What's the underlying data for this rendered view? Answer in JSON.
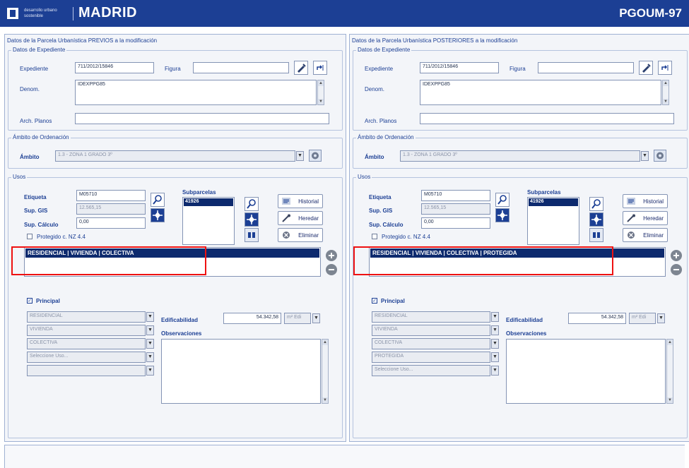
{
  "header": {
    "brand_small": "desarrollo urbano sostenible",
    "brand": "MADRID",
    "app_code": "PGOUM-97"
  },
  "left": {
    "title": "Datos de la Parcela Urbanística PREVIOS a la modificación",
    "expediente_group": "Datos de Expediente",
    "expediente_label": "Expediente",
    "expediente_value": "711/2012/15846",
    "figura_label": "Figura",
    "figura_value": "",
    "denom_label": "Denom.",
    "denom_value": "IDEXPPG85",
    "arch_label": "Arch. Planos",
    "arch_value": "",
    "ambito_group": "Ámbito de Ordenación",
    "ambito_label": "Ámbito",
    "ambito_value": "1.3 - ZONA 1 GRADO 3º",
    "usos_group": "Usos",
    "etiqueta_label": "Etiqueta",
    "etiqueta_value": "M05710",
    "sup_gis_label": "Sup. GIS",
    "sup_gis_value": "12.565,15",
    "sup_calc_label": "Sup. Cálculo",
    "sup_calc_value": "0,00",
    "protegida_label": "Protegido c. NZ 4.4",
    "subparcelas_label": "Subparcelas",
    "subparcela_item": "41926",
    "historial": "Historial",
    "heredar": "Heredar",
    "eliminar": "Eliminar",
    "uso_selected": "RESIDENCIAL | VIVIENDA | COLECTIVA",
    "principal_label": "Principal",
    "combos": [
      "RESIDENCIAL",
      "VIVIENDA",
      "COLECTIVA",
      "Seleccione Uso...",
      ""
    ],
    "edificabilidad_label": "Edificabilidad",
    "edificabilidad_value": "54.342,58",
    "edif_unit": "m² Edi",
    "observaciones_label": "Observaciones"
  },
  "right": {
    "title": "Datos de la Parcela Urbanística POSTERIORES a la modificación",
    "expediente_group": "Datos de Expediente",
    "expediente_label": "Expediente",
    "expediente_value": "711/2012/15846",
    "figura_label": "Figura",
    "figura_value": "",
    "denom_label": "Denom.",
    "denom_value": "IDEXPPG85",
    "arch_label": "Arch. Planos",
    "arch_value": "",
    "ambito_group": "Ámbito de Ordenación",
    "ambito_label": "Ámbito",
    "ambito_value": "1.3 - ZONA 1 GRADO 3º",
    "usos_group": "Usos",
    "etiqueta_label": "Etiqueta",
    "etiqueta_value": "M05710",
    "sup_gis_label": "Sup. GIS",
    "sup_gis_value": "12.565,15",
    "sup_calc_label": "Sup. Cálculo",
    "sup_calc_value": "0,00",
    "protegida_label": "Protegido c. NZ 4.4",
    "subparcelas_label": "Subparcelas",
    "subparcela_item": "41926",
    "historial": "Historial",
    "heredar": "Heredar",
    "eliminar": "Eliminar",
    "uso_selected": "RESIDENCIAL | VIVIENDA | COLECTIVA | PROTEGIDA",
    "principal_label": "Principal",
    "combos": [
      "RESIDENCIAL",
      "VIVIENDA",
      "COLECTIVA",
      "PROTEGIDA",
      "Seleccione Uso..."
    ],
    "edificabilidad_label": "Edificabilidad",
    "edificabilidad_value": "54.342,58",
    "edif_unit": "m² Edi",
    "observaciones_label": "Observaciones"
  },
  "colors": {
    "primary": "#1c3f94",
    "selection": "#0d2a6e",
    "highlight": "#e11111"
  }
}
